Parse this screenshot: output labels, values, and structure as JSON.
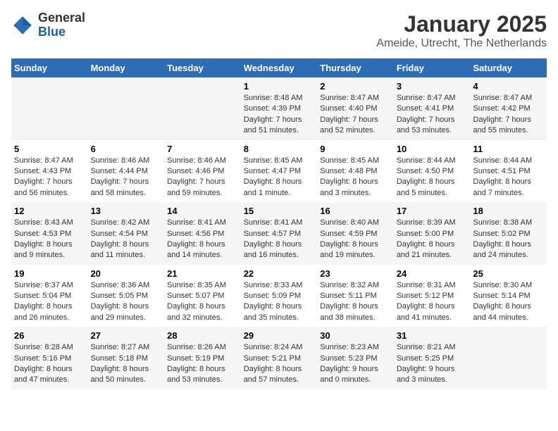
{
  "header": {
    "logo_general": "General",
    "logo_blue": "Blue",
    "title": "January 2025",
    "subtitle": "Ameide, Utrecht, The Netherlands"
  },
  "days_of_week": [
    "Sunday",
    "Monday",
    "Tuesday",
    "Wednesday",
    "Thursday",
    "Friday",
    "Saturday"
  ],
  "weeks": [
    [
      {
        "day": "",
        "content": ""
      },
      {
        "day": "",
        "content": ""
      },
      {
        "day": "",
        "content": ""
      },
      {
        "day": "1",
        "content": "Sunrise: 8:48 AM\nSunset: 4:39 PM\nDaylight: 7 hours and 51 minutes."
      },
      {
        "day": "2",
        "content": "Sunrise: 8:47 AM\nSunset: 4:40 PM\nDaylight: 7 hours and 52 minutes."
      },
      {
        "day": "3",
        "content": "Sunrise: 8:47 AM\nSunset: 4:41 PM\nDaylight: 7 hours and 53 minutes."
      },
      {
        "day": "4",
        "content": "Sunrise: 8:47 AM\nSunset: 4:42 PM\nDaylight: 7 hours and 55 minutes."
      }
    ],
    [
      {
        "day": "5",
        "content": "Sunrise: 8:47 AM\nSunset: 4:43 PM\nDaylight: 7 hours and 56 minutes."
      },
      {
        "day": "6",
        "content": "Sunrise: 8:46 AM\nSunset: 4:44 PM\nDaylight: 7 hours and 58 minutes."
      },
      {
        "day": "7",
        "content": "Sunrise: 8:46 AM\nSunset: 4:46 PM\nDaylight: 7 hours and 59 minutes."
      },
      {
        "day": "8",
        "content": "Sunrise: 8:45 AM\nSunset: 4:47 PM\nDaylight: 8 hours and 1 minute."
      },
      {
        "day": "9",
        "content": "Sunrise: 8:45 AM\nSunset: 4:48 PM\nDaylight: 8 hours and 3 minutes."
      },
      {
        "day": "10",
        "content": "Sunrise: 8:44 AM\nSunset: 4:50 PM\nDaylight: 8 hours and 5 minutes."
      },
      {
        "day": "11",
        "content": "Sunrise: 8:44 AM\nSunset: 4:51 PM\nDaylight: 8 hours and 7 minutes."
      }
    ],
    [
      {
        "day": "12",
        "content": "Sunrise: 8:43 AM\nSunset: 4:53 PM\nDaylight: 8 hours and 9 minutes."
      },
      {
        "day": "13",
        "content": "Sunrise: 8:42 AM\nSunset: 4:54 PM\nDaylight: 8 hours and 11 minutes."
      },
      {
        "day": "14",
        "content": "Sunrise: 8:41 AM\nSunset: 4:56 PM\nDaylight: 8 hours and 14 minutes."
      },
      {
        "day": "15",
        "content": "Sunrise: 8:41 AM\nSunset: 4:57 PM\nDaylight: 8 hours and 16 minutes."
      },
      {
        "day": "16",
        "content": "Sunrise: 8:40 AM\nSunset: 4:59 PM\nDaylight: 8 hours and 19 minutes."
      },
      {
        "day": "17",
        "content": "Sunrise: 8:39 AM\nSunset: 5:00 PM\nDaylight: 8 hours and 21 minutes."
      },
      {
        "day": "18",
        "content": "Sunrise: 8:38 AM\nSunset: 5:02 PM\nDaylight: 8 hours and 24 minutes."
      }
    ],
    [
      {
        "day": "19",
        "content": "Sunrise: 8:37 AM\nSunset: 5:04 PM\nDaylight: 8 hours and 26 minutes."
      },
      {
        "day": "20",
        "content": "Sunrise: 8:36 AM\nSunset: 5:05 PM\nDaylight: 8 hours and 29 minutes."
      },
      {
        "day": "21",
        "content": "Sunrise: 8:35 AM\nSunset: 5:07 PM\nDaylight: 8 hours and 32 minutes."
      },
      {
        "day": "22",
        "content": "Sunrise: 8:33 AM\nSunset: 5:09 PM\nDaylight: 8 hours and 35 minutes."
      },
      {
        "day": "23",
        "content": "Sunrise: 8:32 AM\nSunset: 5:11 PM\nDaylight: 8 hours and 38 minutes."
      },
      {
        "day": "24",
        "content": "Sunrise: 8:31 AM\nSunset: 5:12 PM\nDaylight: 8 hours and 41 minutes."
      },
      {
        "day": "25",
        "content": "Sunrise: 8:30 AM\nSunset: 5:14 PM\nDaylight: 8 hours and 44 minutes."
      }
    ],
    [
      {
        "day": "26",
        "content": "Sunrise: 8:28 AM\nSunset: 5:16 PM\nDaylight: 8 hours and 47 minutes."
      },
      {
        "day": "27",
        "content": "Sunrise: 8:27 AM\nSunset: 5:18 PM\nDaylight: 8 hours and 50 minutes."
      },
      {
        "day": "28",
        "content": "Sunrise: 8:26 AM\nSunset: 5:19 PM\nDaylight: 8 hours and 53 minutes."
      },
      {
        "day": "29",
        "content": "Sunrise: 8:24 AM\nSunset: 5:21 PM\nDaylight: 8 hours and 57 minutes."
      },
      {
        "day": "30",
        "content": "Sunrise: 8:23 AM\nSunset: 5:23 PM\nDaylight: 9 hours and 0 minutes."
      },
      {
        "day": "31",
        "content": "Sunrise: 8:21 AM\nSunset: 5:25 PM\nDaylight: 9 hours and 3 minutes."
      },
      {
        "day": "",
        "content": ""
      }
    ]
  ]
}
